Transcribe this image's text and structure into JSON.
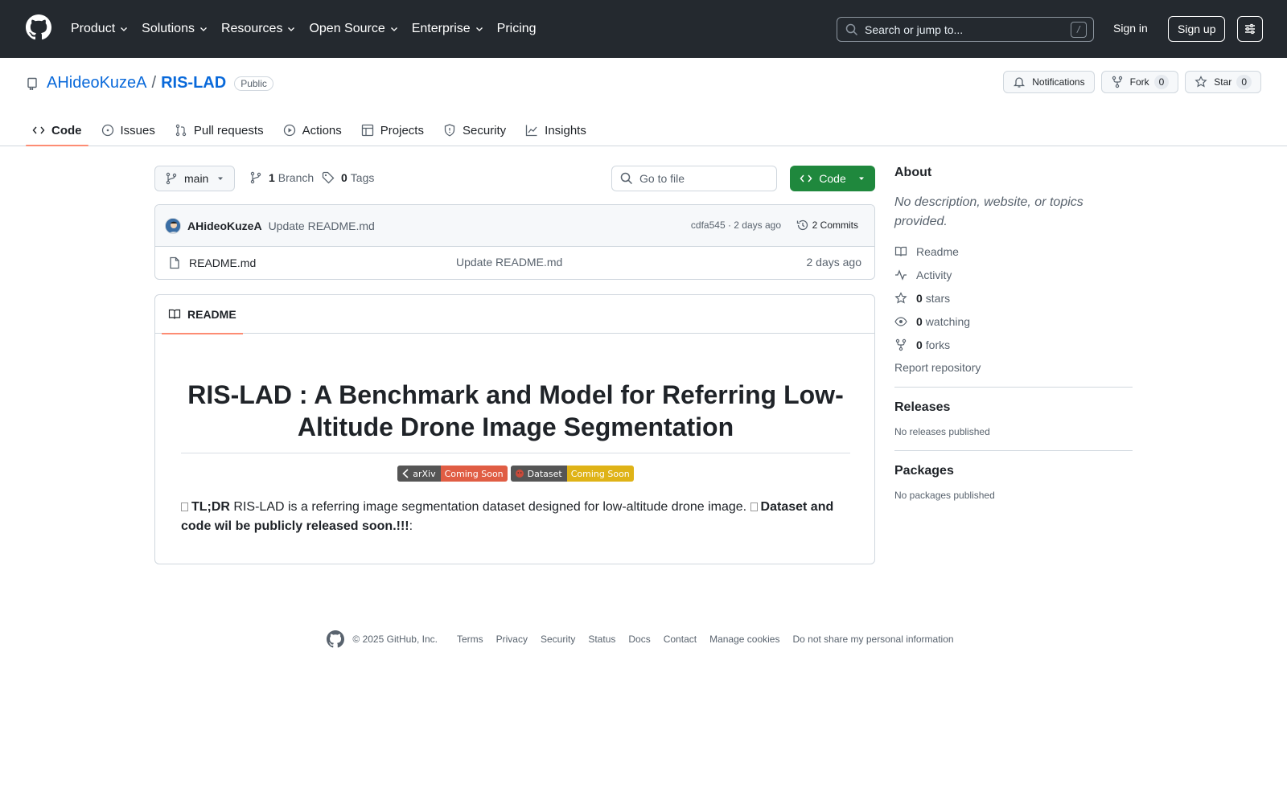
{
  "header": {
    "nav": [
      {
        "label": "Product",
        "dropdown": true
      },
      {
        "label": "Solutions",
        "dropdown": true
      },
      {
        "label": "Resources",
        "dropdown": true
      },
      {
        "label": "Open Source",
        "dropdown": true
      },
      {
        "label": "Enterprise",
        "dropdown": true
      },
      {
        "label": "Pricing",
        "dropdown": false
      }
    ],
    "search_placeholder": "Search or jump to...",
    "search_shortcut": "/",
    "sign_in": "Sign in",
    "sign_up": "Sign up"
  },
  "repo": {
    "owner": "AHideoKuzeA",
    "separator": "/",
    "name": "RIS-LAD",
    "visibility": "Public",
    "notifications_label": "Notifications",
    "fork_label": "Fork",
    "fork_count": "0",
    "star_label": "Star",
    "star_count": "0",
    "tabs": [
      "Code",
      "Issues",
      "Pull requests",
      "Actions",
      "Projects",
      "Security",
      "Insights"
    ]
  },
  "toolbar": {
    "branch": "main",
    "branch_count": "1",
    "branch_label": "Branch",
    "tag_count": "0",
    "tag_label": "Tags",
    "goto_placeholder": "Go to file",
    "code_button": "Code"
  },
  "commit": {
    "author": "AHideoKuzeA",
    "message": "Update README.md",
    "meta": "cdfa545 · 2 days ago",
    "commits_label": "2 Commits"
  },
  "files": [
    {
      "name": "README.md",
      "message": "Update README.md",
      "time": "2 days ago"
    }
  ],
  "readme": {
    "tab_label": "README",
    "title": "RIS-LAD : A Benchmark and Model for Referring Low-Altitude Drone Image Segmentation",
    "badges": [
      {
        "left": "arXiv",
        "right": "Coming Soon",
        "color": "#e05d44"
      },
      {
        "left": "Dataset",
        "right": "Coming Soon",
        "color": "#dfb317"
      }
    ],
    "tldr_label": "TL;DR",
    "tldr_text": " RIS-LAD is a referring image segmentation dataset designed for low-altitude drone image. ",
    "release_text": "Dataset and code wil be publicly released soon.!!!",
    "release_tail": ":"
  },
  "sidebar": {
    "about_title": "About",
    "about_desc": "No description, website, or topics provided.",
    "readme_link": "Readme",
    "activity_link": "Activity",
    "stars_count": "0",
    "stars_label": "stars",
    "watching_count": "0",
    "watching_label": "watching",
    "forks_count": "0",
    "forks_label": "forks",
    "report": "Report repository",
    "releases_title": "Releases",
    "releases_empty": "No releases published",
    "packages_title": "Packages",
    "packages_empty": "No packages published"
  },
  "footer": {
    "copyright": "© 2025 GitHub, Inc.",
    "links": [
      "Terms",
      "Privacy",
      "Security",
      "Status",
      "Docs",
      "Contact",
      "Manage cookies",
      "Do not share my personal information"
    ]
  },
  "colors": {
    "header_bg": "#24292f",
    "link": "#0969da",
    "primary_button": "#1f883d",
    "tab_underline": "#fd8c73"
  }
}
